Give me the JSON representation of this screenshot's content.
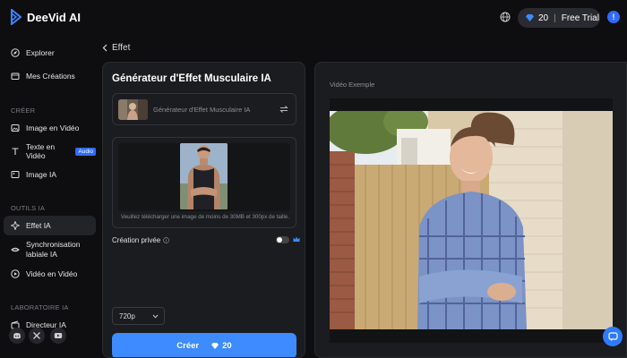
{
  "app": {
    "name": "DeeVid AI"
  },
  "header": {
    "credits": "20",
    "separator": "|",
    "trial": "Free Trial",
    "info": "!"
  },
  "sidebar": {
    "main": [
      {
        "label": "Explorer",
        "icon": "compass-icon"
      },
      {
        "label": "Mes Créations",
        "icon": "folder-icon"
      }
    ],
    "section_create": "CRÉER",
    "create": [
      {
        "label": "Image en Vidéo",
        "icon": "image-icon"
      },
      {
        "label": "Texte en Vidéo",
        "badge": "Audio",
        "icon": "text-icon"
      },
      {
        "label": "Image IA",
        "icon": "image-icon"
      }
    ],
    "section_tools": "OUTILS IA",
    "tools": [
      {
        "label": "Effet IA",
        "icon": "sparkle-icon",
        "active": true
      },
      {
        "label": "Synchronisation labiale IA",
        "icon": "lips-icon"
      },
      {
        "label": "Vidéo en Vidéo",
        "icon": "video-icon"
      }
    ],
    "section_lab": "LABORATOIRE IA",
    "lab": [
      {
        "label": "Directeur IA",
        "icon": "director-icon"
      }
    ],
    "social": [
      "discord-icon",
      "x-icon",
      "youtube-icon"
    ]
  },
  "breadcrumb": {
    "label": "Effet"
  },
  "generator": {
    "title": "Générateur d'Effet Musculaire IA",
    "effect_name": "Générateur d'Effet Musculaire IA",
    "upload_note": "Veuillez télécharger une image de moins de 30MB et 300px de taille.",
    "private_label": "Création privée",
    "resolution": "720p",
    "create_label": "Créer",
    "create_cost": "20"
  },
  "example": {
    "label": "Vidéo Exemple"
  },
  "colors": {
    "accent": "#3d8bff",
    "background": "#0e0e10",
    "panel": "#1b1c1f"
  }
}
